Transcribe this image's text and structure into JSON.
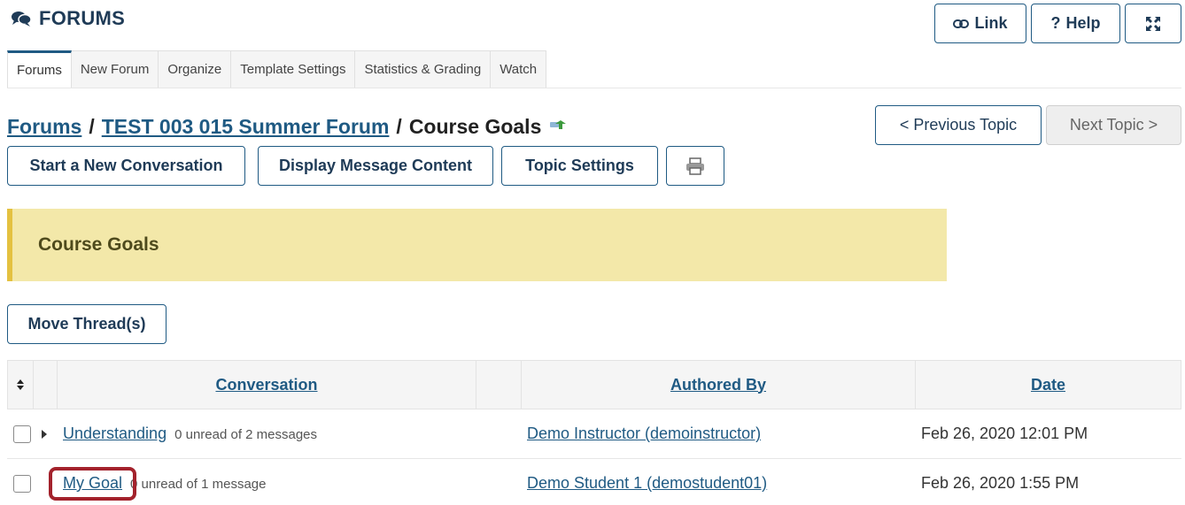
{
  "header": {
    "title": "FORUMS",
    "icon": "comments-icon"
  },
  "top_buttons": {
    "link_label": "Link",
    "help_label": "Help",
    "help_prefix": "?"
  },
  "tabs": [
    {
      "label": "Forums",
      "active": true
    },
    {
      "label": "New Forum"
    },
    {
      "label": "Organize"
    },
    {
      "label": "Template Settings"
    },
    {
      "label": "Statistics & Grading"
    },
    {
      "label": "Watch"
    }
  ],
  "breadcrumb": {
    "forums": "Forums",
    "forum": "TEST 003 015 Summer Forum",
    "topic": "Course Goals",
    "sep": "/"
  },
  "nav": {
    "prev": "< Previous Topic",
    "next": "Next Topic >"
  },
  "actions": {
    "start": "Start a New Conversation",
    "display": "Display Message Content",
    "settings": "Topic Settings"
  },
  "banner": {
    "title": "Course Goals"
  },
  "move_label": "Move Thread(s)",
  "table": {
    "columns": {
      "conversation": "Conversation",
      "authored_by": "Authored By",
      "date": "Date"
    },
    "rows": [
      {
        "title": "Understanding",
        "meta": "0 unread of 2 messages",
        "author": "Demo Instructor (demoinstructor)",
        "date": "Feb 26, 2020 12:01 PM",
        "expandable": true
      },
      {
        "title": "My Goal",
        "meta": "0 unread of 1 message",
        "author": "Demo Student 1 (demostudent01)",
        "date": "Feb 26, 2020 1:55 PM",
        "highlighted": true
      }
    ]
  },
  "colors": {
    "link": "#1f5a83",
    "banner_bg": "#f3e8a9",
    "banner_border": "#e4c140",
    "highlight": "#a3222c"
  }
}
